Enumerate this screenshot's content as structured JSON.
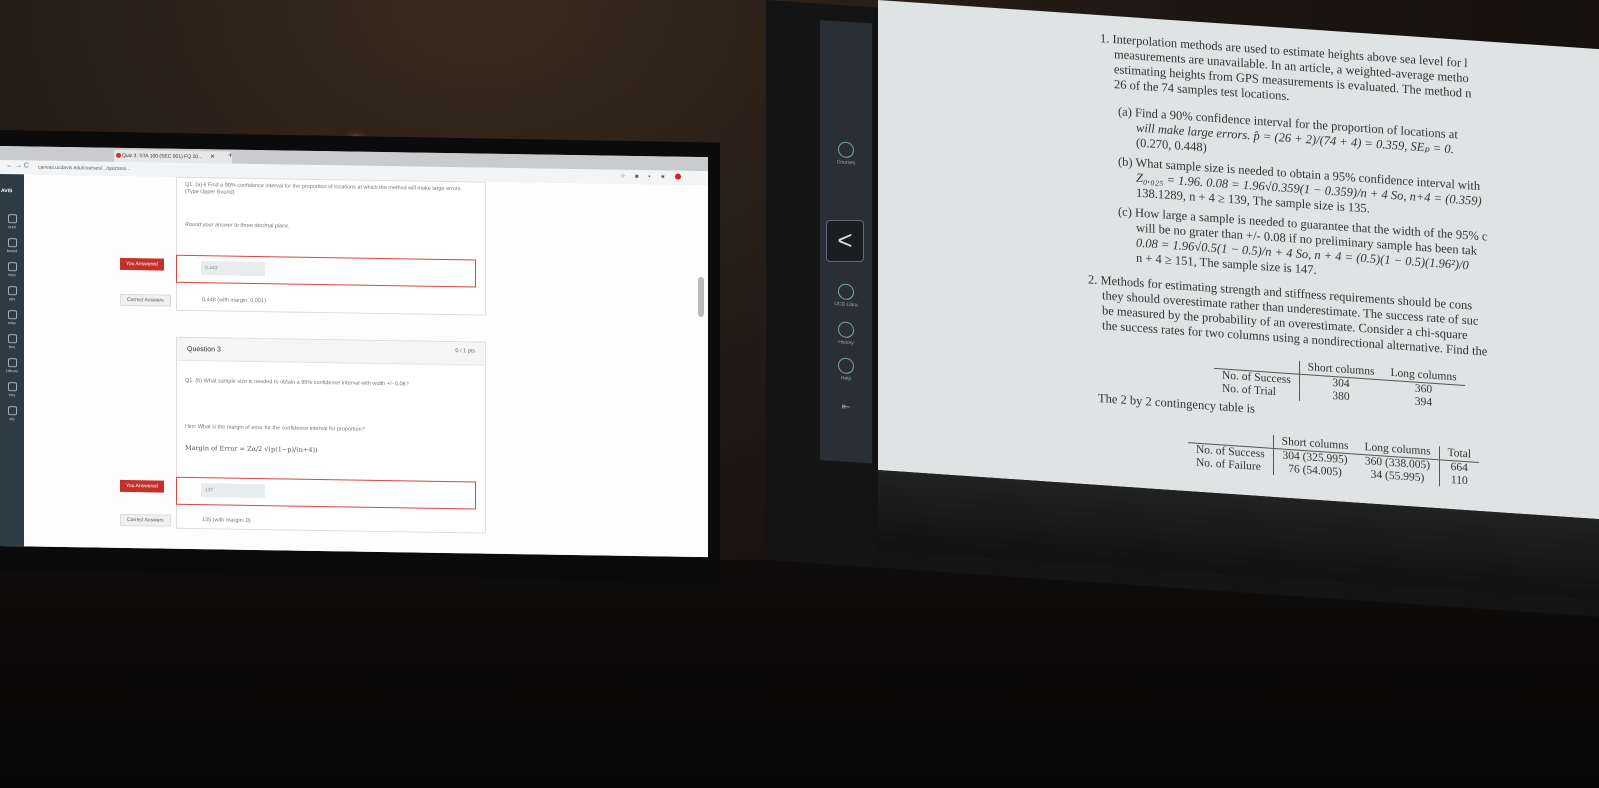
{
  "browser": {
    "tab_title": "Quiz 3: STA 100 (SEC 001) FQ 20...",
    "new_tab": "+",
    "url": "canvas.ucdavis.edu/courses/.../quizzes/..."
  },
  "sidebar": {
    "logo": "AVIS",
    "items": [
      {
        "label": "ount",
        "icon": "account-icon"
      },
      {
        "label": "board",
        "icon": "dashboard-icon"
      },
      {
        "label": "rses",
        "icon": "courses-icon"
      },
      {
        "label": "ups",
        "icon": "groups-icon"
      },
      {
        "label": "ndar",
        "icon": "calendar-icon"
      },
      {
        "label": "box",
        "icon": "inbox-icon"
      },
      {
        "label": "Library",
        "icon": "library-icon"
      },
      {
        "label": "tory",
        "icon": "history-icon"
      },
      {
        "label": "elp",
        "icon": "help-icon"
      }
    ]
  },
  "quiz": {
    "q1": {
      "text": "Q1. (a)-ii Find a 90% confidence interval for the proportion of locations at which the method will make large errors. (Type Upper Bound)",
      "instruction": "Round your answer to three decimal place.",
      "you_answered_label": "You Answered",
      "your_answer": "0.443",
      "correct_label": "Correct Answers",
      "correct_answer": "0.448 (with margin: 0.001)"
    },
    "q3": {
      "title": "Question 3",
      "points": "0 / 1 pts",
      "text": "Q1. (b) What sample size is needed to obtain a 95% confidence interval with width +/- 0.08?",
      "hint": "Hint: What is the margin of error for the confidence interval for proportion?",
      "formula": "Margin of Error = Zα/2 √(p(1−p)/(n+4))",
      "you_answered_label": "You Answered",
      "your_answer": "137",
      "correct_label": "Correct Answers",
      "correct_answer": "135 (with margin: 0)"
    }
  },
  "viewer": {
    "prev_button": "<",
    "items": [
      {
        "label": "Courses",
        "icon": "courses-icon"
      },
      {
        "label": "UCD Libra",
        "icon": "library-icon"
      },
      {
        "label": "History",
        "icon": "history-icon"
      },
      {
        "label": "Help",
        "icon": "help-icon"
      },
      {
        "label": "",
        "icon": "collapse-arrow-icon"
      }
    ]
  },
  "document": {
    "lines": [
      "1. Interpolation methods are used to estimate heights above sea level for l",
      "measurements are unavailable. In an article, a weighted-average metho",
      "estimating heights from GPS measurements is evaluated. The method n",
      "26 of the 74 samples test locations.",
      "(a) Find a 90% confidence interval for the proportion of locations at",
      "will make large errors. p̂ = (26 + 2)/(74 + 4) = 0.359, SEₚ = 0.",
      "(0.270, 0.448)",
      "(b) What sample size is needed to obtain a 95% confidence interval with",
      "Z₀.₀₂₅ = 1.96. 0.08 = 1.96√0.359(1 − 0.359)/n + 4 So, n+4 = (0.359)",
      "138.1289, n + 4 ≥ 139, The sample size is 135.",
      "(c) How large a sample is needed to guarantee that the width of the 95% c",
      "will be no grater than +/- 0.08 if no preliminary sample has been tak",
      "0.08 = 1.96√0.5(1 − 0.5)/n + 4 So, n + 4 = (0.5)(1 − 0.5)(1.96²)/0",
      "n + 4 ≥ 151, The sample size is 147.",
      "2. Methods for estimating strength and stiffness requirements should be cons",
      "they should overestimate rather than underestimate. The success rate of suc",
      "be measured by the probability of an overestimate. Consider a chi-square",
      "the success rates for two columns using a nondirectional alternative. Find the"
    ],
    "table1": {
      "headers": [
        "",
        "Short columns",
        "Long columns"
      ],
      "rows": [
        [
          "No. of Success",
          "304",
          "360"
        ],
        [
          "No. of Trial",
          "380",
          "394"
        ]
      ]
    },
    "contingency_caption": "The 2 by 2 contingency table is",
    "table2": {
      "headers": [
        "",
        "Short columns",
        "Long columns",
        "Total"
      ],
      "rows": [
        [
          "No. of Success",
          "304 (325.995)",
          "360 (338.005)",
          "664"
        ],
        [
          "No. of Failure",
          "76 (54.005)",
          "34 (55.995)",
          "110"
        ]
      ]
    }
  }
}
